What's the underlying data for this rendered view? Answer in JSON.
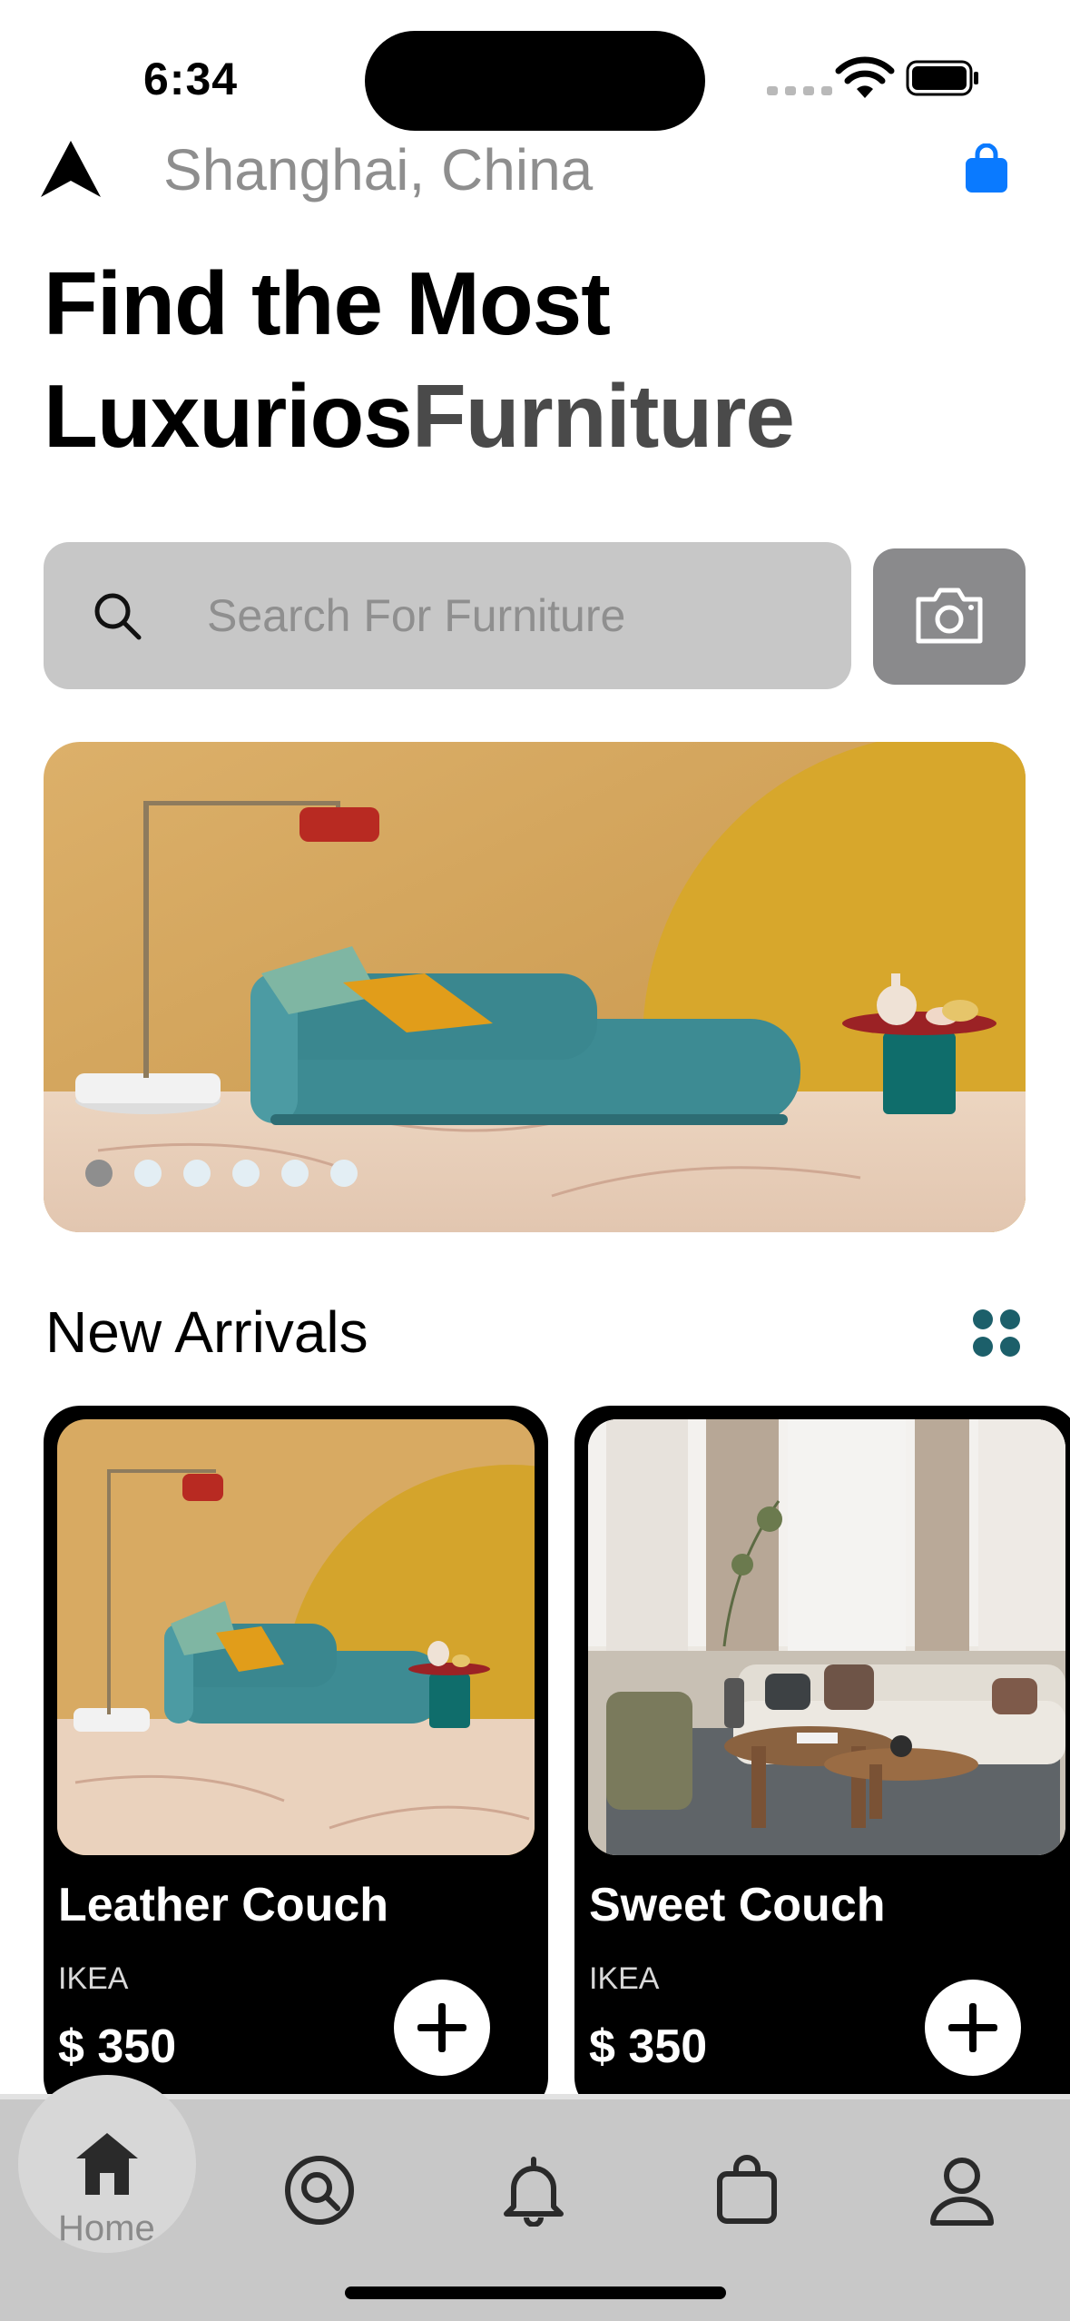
{
  "status_bar": {
    "time": "6:34"
  },
  "header": {
    "location": "Shanghai, China",
    "headline_line1": "Find the Most",
    "headline_line2_bold": "Luxurios",
    "headline_line2_accent": "Furniture",
    "accent_color": "#4a4a4a",
    "cart_icon": "shopping-bag-icon",
    "cart_color": "#0a7aff"
  },
  "search": {
    "placeholder": "Search For Furniture",
    "camera_icon": "camera-icon"
  },
  "banner": {
    "slide_count": 6,
    "active_slide": 1
  },
  "new_arrivals": {
    "title": "New Arrivals",
    "view_toggle_icon": "grid-icon",
    "products": [
      {
        "name": "Leather Couch",
        "brand": "IKEA",
        "price": "$ 350"
      },
      {
        "name": "Sweet Couch",
        "brand": "IKEA",
        "price": "$ 350"
      }
    ]
  },
  "tab_bar": {
    "active": "Home",
    "items": [
      {
        "label": "Home",
        "icon": "home-icon"
      },
      {
        "icon": "search-icon"
      },
      {
        "icon": "bell-icon"
      },
      {
        "icon": "bag-icon"
      },
      {
        "icon": "profile-icon"
      }
    ]
  }
}
